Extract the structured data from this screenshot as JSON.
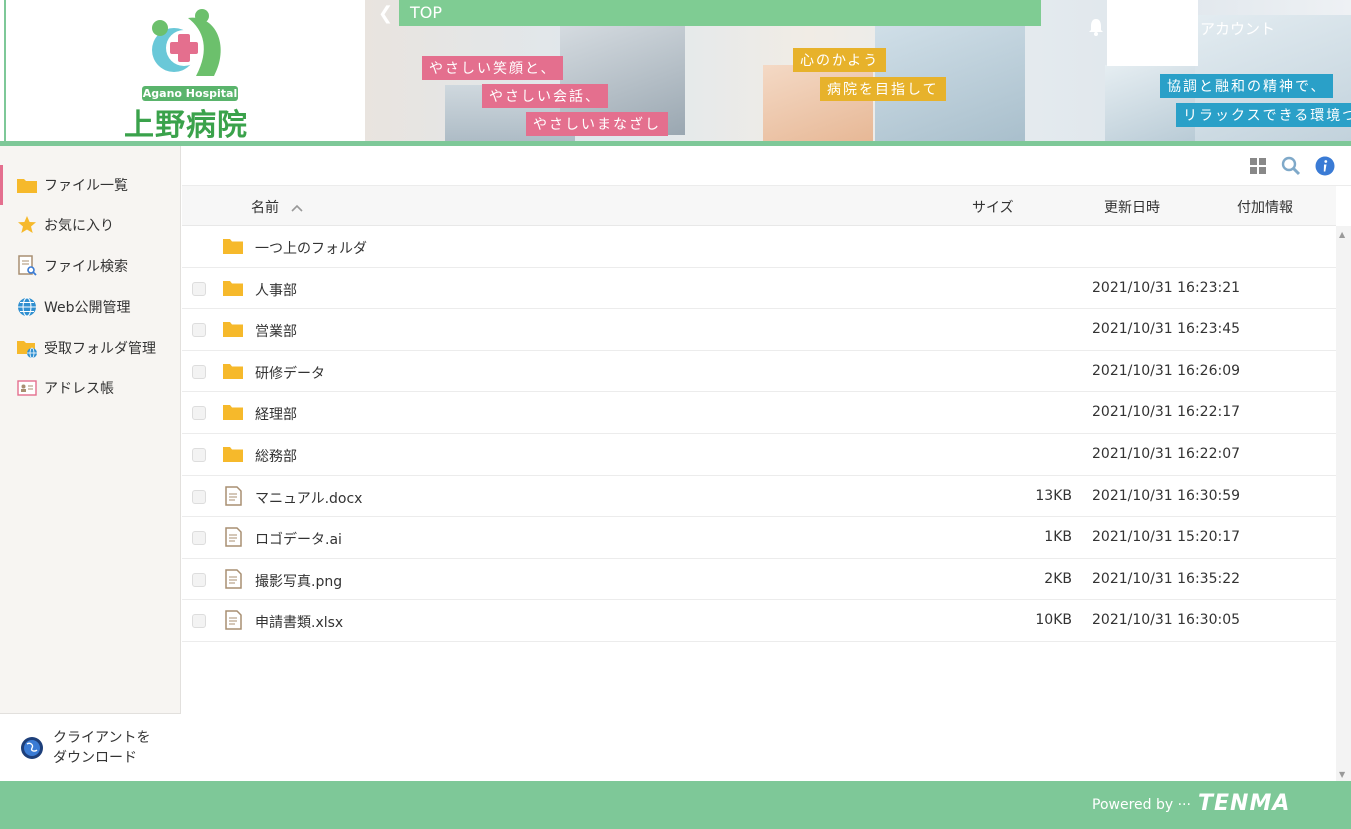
{
  "logo": {
    "en": "Agano Hospital",
    "jp": "上野病院"
  },
  "banner": {
    "texts": [
      "やさしい笑顔と、",
      "やさしい会話、",
      "やさしいまなざし",
      "心のかよう",
      "病院を目指して",
      "協調と融和の精神で、",
      "リラックスできる環境づ"
    ]
  },
  "nav": {
    "top_label": "TOP",
    "account_label": "アカウント"
  },
  "sidebar": {
    "items": [
      {
        "label": "ファイル一覧",
        "icon": "folder-icon"
      },
      {
        "label": "お気に入り",
        "icon": "star-icon"
      },
      {
        "label": "ファイル検索",
        "icon": "file-search-icon"
      },
      {
        "label": "Web公開管理",
        "icon": "globe-icon"
      },
      {
        "label": "受取フォルダ管理",
        "icon": "folder-globe-icon"
      },
      {
        "label": "アドレス帳",
        "icon": "address-book-icon"
      }
    ],
    "download_line1": "クライアントを",
    "download_line2": "ダウンロード"
  },
  "table": {
    "headers": {
      "name": "名前",
      "size": "サイズ",
      "updated": "更新日時",
      "extra": "付加情報"
    },
    "parent_folder": "一つ上のフォルダ",
    "rows": [
      {
        "name": "人事部",
        "type": "folder",
        "size": "",
        "updated": "2021/10/31 16:23:21"
      },
      {
        "name": "営業部",
        "type": "folder",
        "size": "",
        "updated": "2021/10/31 16:23:45"
      },
      {
        "name": "研修データ",
        "type": "folder",
        "size": "",
        "updated": "2021/10/31 16:26:09"
      },
      {
        "name": "経理部",
        "type": "folder",
        "size": "",
        "updated": "2021/10/31 16:22:17"
      },
      {
        "name": "総務部",
        "type": "folder",
        "size": "",
        "updated": "2021/10/31 16:22:07"
      },
      {
        "name": "マニュアル.docx",
        "type": "file",
        "size": "13KB",
        "updated": "2021/10/31 16:30:59"
      },
      {
        "name": "ロゴデータ.ai",
        "type": "file",
        "size": "1KB",
        "updated": "2021/10/31 15:20:17"
      },
      {
        "name": "撮影写真.png",
        "type": "file",
        "size": "2KB",
        "updated": "2021/10/31 16:35:22"
      },
      {
        "name": "申請書類.xlsx",
        "type": "file",
        "size": "10KB",
        "updated": "2021/10/31 16:30:05"
      }
    ]
  },
  "footer": {
    "powered_by": "Powered by ···",
    "brand": "TENMA"
  },
  "colors": {
    "accent": "#7ec898",
    "pink": "#e46f8e",
    "folder": "#f6b92b",
    "info": "#3a7bd5"
  }
}
